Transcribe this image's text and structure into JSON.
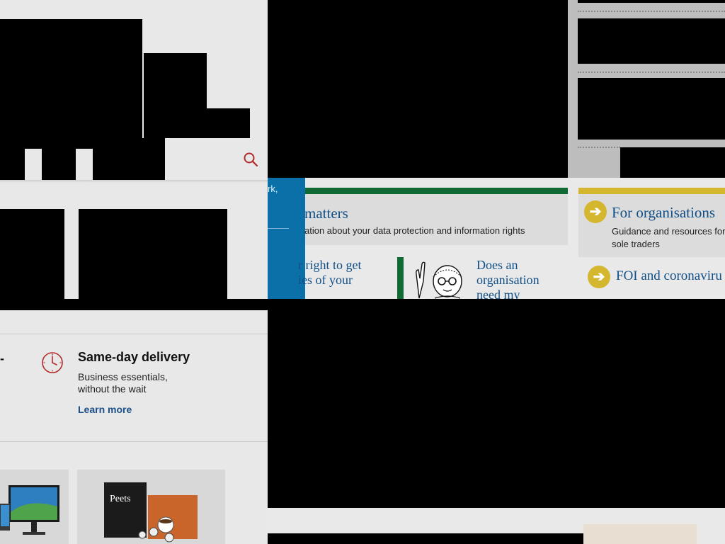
{
  "left": {
    "feature": {
      "cut_word": "-",
      "title": "Same-day delivery",
      "desc": "Business essentials, without the wait",
      "link": "Learn more"
    },
    "tile_brand": "Peets"
  },
  "strip": {
    "blue_text": "rk,",
    "card1": {
      "title": "matters",
      "desc": "ation about your data protection and information rights"
    },
    "link_a": "r right to get\nies of your",
    "link_b": "Does an organisation need my",
    "card2": {
      "title": "For organisations",
      "desc": "Guidance and resources for sole traders"
    },
    "foi": "FOI and coronaviru"
  },
  "colors": {
    "ico_blue": "#114f86",
    "ico_green": "#0f6a33",
    "ico_yellow": "#d4b72e",
    "blue_panel": "#0b70a8",
    "retail_link": "#1b4f8a",
    "retail_accent": "#b22a2a"
  },
  "icons": [
    "search-icon",
    "clock-icon",
    "arrow-right-icon"
  ]
}
